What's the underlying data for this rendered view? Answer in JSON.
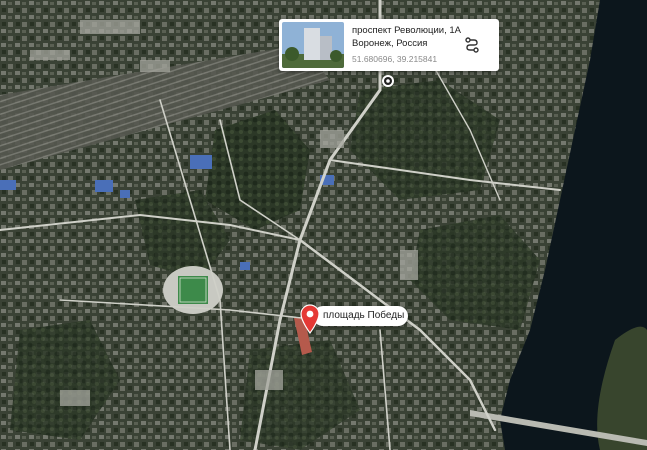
{
  "map": {
    "view": "satellite",
    "colors": {
      "vegetation": "#2f3b29",
      "river": "#0c161c",
      "roads": "#cfd0c8",
      "pin": "#e53935"
    }
  },
  "info_card": {
    "address_line1": "проспект Революции, 1А",
    "address_line2": "Воронеж, Россия",
    "coordinates": "51.680696, 39.215841",
    "route_icon": "route-icon"
  },
  "marker": {
    "label": "площадь Победы",
    "icon": "map-pin-icon"
  }
}
